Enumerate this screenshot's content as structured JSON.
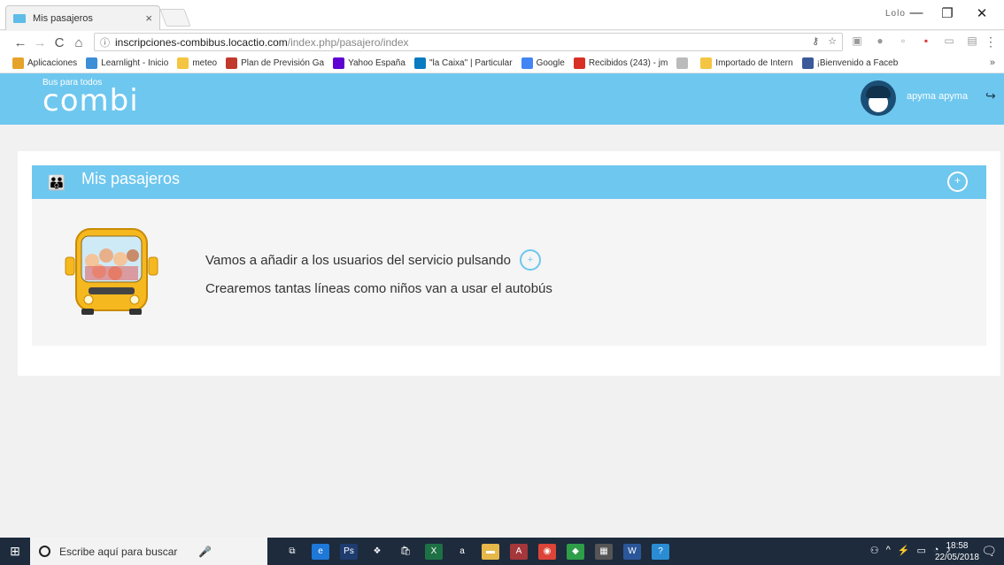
{
  "browser": {
    "tab_title": "Mis pasajeros",
    "tab_close": "×",
    "profile_label": "Lolo",
    "window_controls": {
      "minimize": "—",
      "maximize": "❐",
      "close": "✕"
    },
    "nav": {
      "back": "←",
      "forward": "→",
      "reload": "C",
      "home": "⌂"
    },
    "url_host": "inscripciones-combibus.locactio.com",
    "url_path": "/index.php/pasajero/index",
    "bookmarks": [
      {
        "label": "Aplicaciones",
        "color": "#e5a32b"
      },
      {
        "label": "Learnlight - Inicio",
        "color": "#3c8ed6"
      },
      {
        "label": "meteo",
        "color": "#f4c542"
      },
      {
        "label": "Plan de Previsión Ga",
        "color": "#c0392b"
      },
      {
        "label": "Yahoo España",
        "color": "#5f01d1"
      },
      {
        "label": "\"la Caixa\" | Particular",
        "color": "#0a7bc0"
      },
      {
        "label": "Google",
        "color": "#4285f4"
      },
      {
        "label": "Recibidos (243) - jm",
        "color": "#d93025"
      },
      {
        "label": "",
        "color": "#bbbbbb"
      },
      {
        "label": "Importado de Intern",
        "color": "#f4c542"
      },
      {
        "label": "¡Bienvenido a Faceb",
        "color": "#3b5998"
      }
    ],
    "bookmarks_more": "»"
  },
  "app": {
    "logo_tagline": "Bus para todos",
    "logo_name": "combi",
    "username": "apyma apyma",
    "logout_icon": "↪"
  },
  "panel": {
    "title": "Mis pasajeros",
    "add_icon": "+",
    "message_line1": "Vamos a añadir a los usuarios del servicio pulsando",
    "message_line2": "Crearemos tantas líneas como niños van a usar el autobús"
  },
  "taskbar": {
    "search_placeholder": "Escribe aquí para buscar",
    "time": "18:58",
    "date": "22/05/2018",
    "apps": [
      {
        "name": "task-view",
        "label": "⧉",
        "color": "#1d2b3d"
      },
      {
        "name": "edge",
        "label": "e",
        "color": "#1e78d8"
      },
      {
        "name": "photoshop",
        "label": "Ps",
        "color": "#1f3c6e"
      },
      {
        "name": "dropbox",
        "label": "❖",
        "color": "#1d2b3d"
      },
      {
        "name": "store",
        "label": "🛍",
        "color": "#1d2b3d"
      },
      {
        "name": "excel",
        "label": "X",
        "color": "#1e7145"
      },
      {
        "name": "amazon",
        "label": "a",
        "color": "#1d2b3d"
      },
      {
        "name": "explorer",
        "label": "▬",
        "color": "#e6b84a"
      },
      {
        "name": "access",
        "label": "A",
        "color": "#a4373a"
      },
      {
        "name": "chrome",
        "label": "◉",
        "color": "#db4437"
      },
      {
        "name": "app-green",
        "label": "◆",
        "color": "#2e9e49"
      },
      {
        "name": "calculator",
        "label": "▦",
        "color": "#555555"
      },
      {
        "name": "word",
        "label": "W",
        "color": "#2b579a"
      },
      {
        "name": "help",
        "label": "?",
        "color": "#2a8dd4"
      }
    ]
  }
}
